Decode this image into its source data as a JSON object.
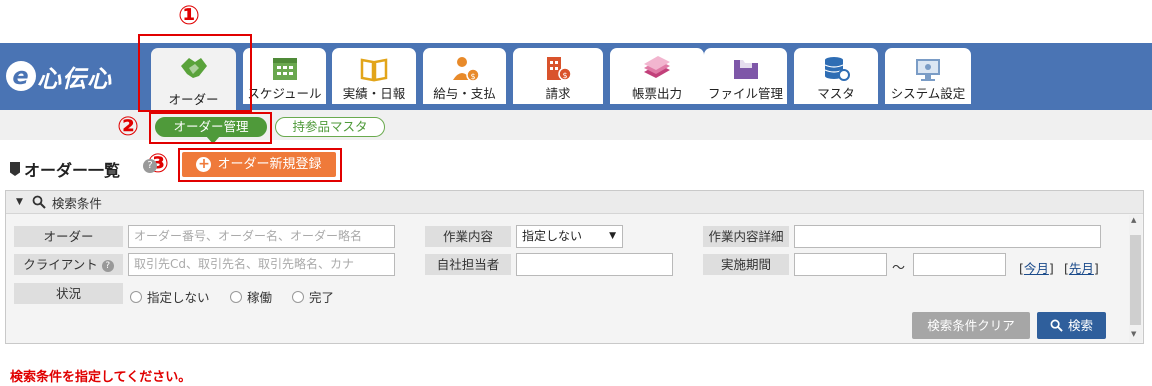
{
  "app": {
    "logo_text": "心伝心",
    "logo_letter": "e"
  },
  "nav": {
    "tabs": [
      {
        "label": "オーダー"
      },
      {
        "label": "スケジュール"
      },
      {
        "label": "実績・日報"
      },
      {
        "label": "給与・支払"
      },
      {
        "label": "請求"
      },
      {
        "label": "帳票出力"
      },
      {
        "label": "ファイル管理"
      },
      {
        "label": "マスタ"
      },
      {
        "label": "システム設定"
      }
    ]
  },
  "annotations": {
    "n1": "①",
    "n2": "②",
    "n3": "③"
  },
  "subnav": {
    "order_management": "オーダー管理",
    "items_master": "持参品マスタ"
  },
  "page": {
    "title": "オーダー一覧",
    "new_button": "オーダー新規登録",
    "help": "?"
  },
  "search": {
    "header": "検索条件",
    "order_label": "オーダー",
    "order_placeholder": "オーダー番号、オーダー名、オーダー略名",
    "client_label": "クライアント",
    "client_placeholder": "取引先Cd、取引先名、取引先略名、カナ",
    "status_label": "状況",
    "status_options": [
      "指定しない",
      "稼働",
      "完了"
    ],
    "work_label": "作業内容",
    "work_value": "指定しない",
    "staff_label": "自社担当者",
    "detail_label": "作業内容詳細",
    "period_label": "実施期間",
    "tilde": "～",
    "this_month": "今月",
    "last_month": "先月",
    "clear_button": "検索条件クリア",
    "search_button": "検索"
  },
  "message": {
    "warning": "検索条件を指定してください。"
  },
  "colors": {
    "header": "#4a74b4",
    "accent_green": "#4f9a3a",
    "orange": "#ef7a3a",
    "search_blue": "#2f5f9c",
    "red": "#e00000"
  }
}
